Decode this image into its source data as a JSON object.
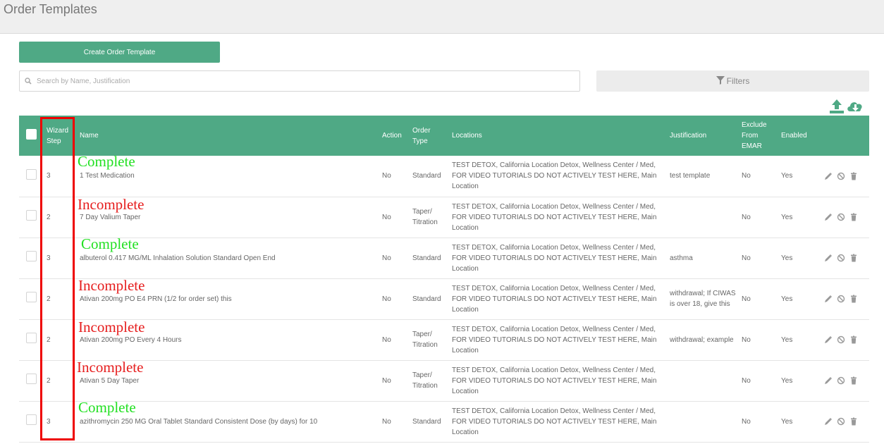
{
  "page": {
    "title": "Order Templates"
  },
  "toolbar": {
    "create_label": "Create Order Template",
    "search_placeholder": "Search by Name, Justification",
    "filters_label": "Filters"
  },
  "colors": {
    "accent": "#4fa985",
    "annotation_complete": "#22e022",
    "annotation_incomplete": "#e61e1e",
    "highlight_box": "#ee0000"
  },
  "icons": {
    "upload": "upload-icon",
    "download": "cloud-download-icon",
    "search": "search-icon",
    "filter": "funnel-icon",
    "edit": "pencil-icon",
    "disable": "ban-icon",
    "delete": "trash-icon"
  },
  "table": {
    "headers": {
      "wizard_step": "Wizard Step",
      "name": "Name",
      "action": "Action",
      "order_type": "Order Type",
      "locations": "Locations",
      "justification": "Justification",
      "exclude": "Exclude From EMAR",
      "enabled": "Enabled"
    },
    "rows": [
      {
        "wizard_step": "3",
        "name": "1 Test Medication",
        "action": "No",
        "order_type": "Standard",
        "locations": "TEST DETOX, California Location Detox, Wellness Center / Med, FOR VIDEO TUTORIALS DO NOT ACTIVELY TEST HERE, Main Location",
        "justification": "test template",
        "exclude": "No",
        "enabled": "Yes",
        "annotation": "Complete"
      },
      {
        "wizard_step": "2",
        "name": "7 Day Valium Taper",
        "action": "No",
        "order_type": "Taper/ Titration",
        "locations": "TEST DETOX, California Location Detox, Wellness Center / Med, FOR VIDEO TUTORIALS DO NOT ACTIVELY TEST HERE, Main Location",
        "justification": "",
        "exclude": "No",
        "enabled": "Yes",
        "annotation": "Incomplete"
      },
      {
        "wizard_step": "3",
        "name": "albuterol 0.417 MG/ML Inhalation Solution Standard Open End",
        "action": "No",
        "order_type": "Standard",
        "locations": "TEST DETOX, California Location Detox, Wellness Center / Med, FOR VIDEO TUTORIALS DO NOT ACTIVELY TEST HERE, Main Location",
        "justification": "asthma",
        "exclude": "No",
        "enabled": "Yes",
        "annotation": "Complete"
      },
      {
        "wizard_step": "2",
        "name": "Ativan 200mg PO E4 PRN (1/2 for order set) this",
        "action": "No",
        "order_type": "Standard",
        "locations": "TEST DETOX, California Location Detox, Wellness Center / Med, FOR VIDEO TUTORIALS DO NOT ACTIVELY TEST HERE, Main Location",
        "justification": "withdrawal; If CIWAS is over 18, give this",
        "exclude": "No",
        "enabled": "Yes",
        "annotation": "Incomplete"
      },
      {
        "wizard_step": "2",
        "name": "Ativan 200mg PO Every 4 Hours",
        "action": "No",
        "order_type": "Taper/ Titration",
        "locations": "TEST DETOX, California Location Detox, Wellness Center / Med, FOR VIDEO TUTORIALS DO NOT ACTIVELY TEST HERE, Main Location",
        "justification": "withdrawal; example",
        "exclude": "No",
        "enabled": "Yes",
        "annotation": "Incomplete"
      },
      {
        "wizard_step": "2",
        "name": "Ativan 5 Day Taper",
        "action": "No",
        "order_type": "Taper/ Titration",
        "locations": "TEST DETOX, California Location Detox, Wellness Center / Med, FOR VIDEO TUTORIALS DO NOT ACTIVELY TEST HERE, Main Location",
        "justification": "",
        "exclude": "No",
        "enabled": "Yes",
        "annotation": "Incomplete"
      },
      {
        "wizard_step": "3",
        "name": "azithromycin 250 MG Oral Tablet Standard Consistent Dose (by days) for 10",
        "action": "No",
        "order_type": "Standard",
        "locations": "TEST DETOX, California Location Detox, Wellness Center / Med, FOR VIDEO TUTORIALS DO NOT ACTIVELY TEST HERE, Main Location",
        "justification": "",
        "exclude": "No",
        "enabled": "Yes",
        "annotation": "Complete"
      }
    ]
  }
}
